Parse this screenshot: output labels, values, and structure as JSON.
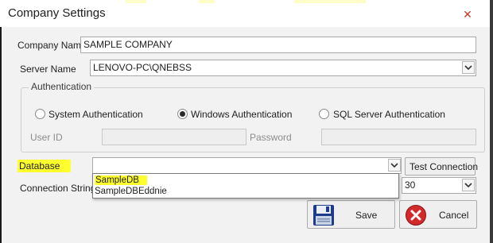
{
  "window": {
    "title": "Company Settings",
    "close_glyph": "✕"
  },
  "form": {
    "company_name_label": "Company Name",
    "company_name_value": "SAMPLE COMPANY",
    "server_name_label": "Server Name",
    "server_name_value": "LENOVO-PC\\QNEBSS",
    "authentication": {
      "group_label": "Authentication",
      "options": [
        "System Authentication",
        "Windows Authentication",
        "SQL Server Authentication"
      ],
      "selected": "Windows Authentication",
      "user_id_label": "User ID",
      "user_id_value": "",
      "password_label": "Password",
      "password_value": ""
    },
    "database_label": "Database",
    "database_value": "",
    "database_options": [
      "SampleDB",
      "SampleDBEddnie"
    ],
    "highlighted_option": "SampleDB",
    "connection_string_label": "Connection String",
    "connection_string_value_visible": "30"
  },
  "buttons": {
    "test_connection": "Test Connection",
    "save": "Save",
    "cancel": "Cancel"
  },
  "icons": {
    "dropdown": "chevron-down-icon",
    "save": "floppy-disk-icon",
    "cancel": "cancel-x-icon",
    "close": "close-icon"
  },
  "colors": {
    "highlight": "#ffff2e",
    "cancel_icon": "#d22a2a",
    "save_icon": "#1e3a8a"
  }
}
